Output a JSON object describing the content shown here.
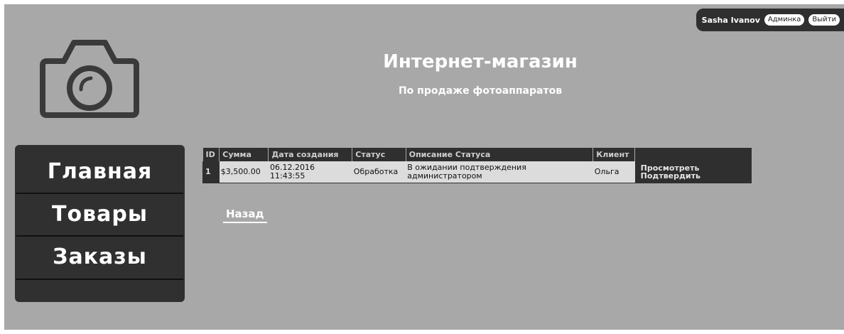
{
  "user": {
    "name": "Sasha Ivanov",
    "admin_label": "Админка",
    "logout_label": "Выйти"
  },
  "header": {
    "logo_icon": "camera-icon",
    "title": "Интернет-магазин",
    "subtitle": "По продаже фотоаппаратов"
  },
  "sidebar": {
    "items": [
      {
        "label": "Главная"
      },
      {
        "label": "Товары"
      },
      {
        "label": "Заказы"
      }
    ]
  },
  "orders": {
    "columns": [
      "ID",
      "Сумма",
      "Дата создания",
      "Статус",
      "Описание Статуса",
      "Клиент",
      ""
    ],
    "rows": [
      {
        "id": "1",
        "sum": "$3,500.00",
        "date": "06.12.2016",
        "time": "11:43:55",
        "status": "Обработка",
        "description_line1": "В ожидании подтверждения",
        "description_line2": "администратором",
        "client": "Ольга",
        "view_label": "Просмотреть",
        "confirm_label": "Подтвердить"
      }
    ]
  },
  "back_label": "Назад",
  "colors": {
    "background": "#a8a8a8",
    "dark": "#2f2f2f",
    "row": "#dcdcdc"
  }
}
